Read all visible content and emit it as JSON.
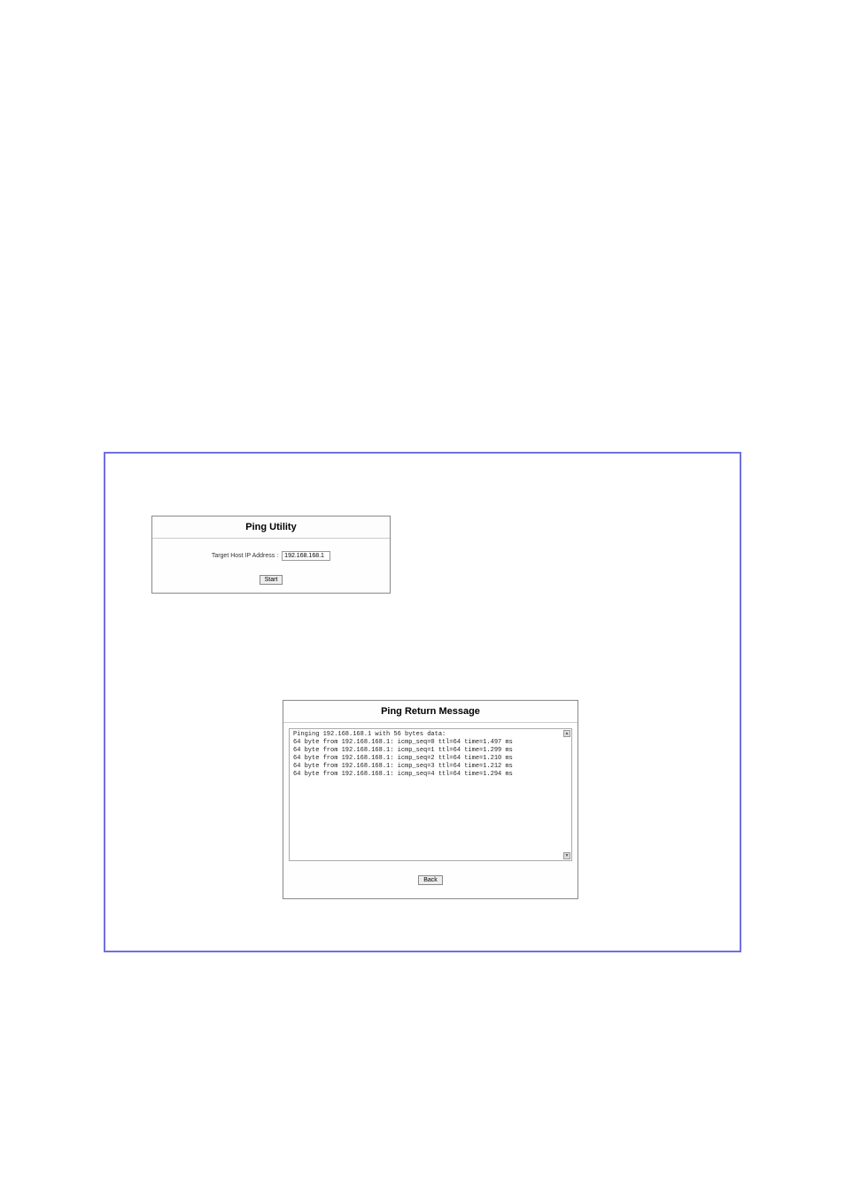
{
  "ping_utility": {
    "title": "Ping Utility",
    "label": "Target Host IP Address :",
    "value": "192.168.168.1",
    "start_button": "Start"
  },
  "ping_return": {
    "title": "Ping Return Message",
    "output": "Pinging 192.168.168.1 with 56 bytes data:\n64 byte from 192.168.168.1: icmp_seq=0 ttl=64 time=1.497 ms\n64 byte from 192.168.168.1: icmp_seq=1 ttl=64 time=1.299 ms\n64 byte from 192.168.168.1: icmp_seq=2 ttl=64 time=1.210 ms\n64 byte from 192.168.168.1: icmp_seq=3 ttl=64 time=1.212 ms\n64 byte from 192.168.168.1: icmp_seq=4 ttl=64 time=1.294 ms",
    "back_button": "Back"
  }
}
